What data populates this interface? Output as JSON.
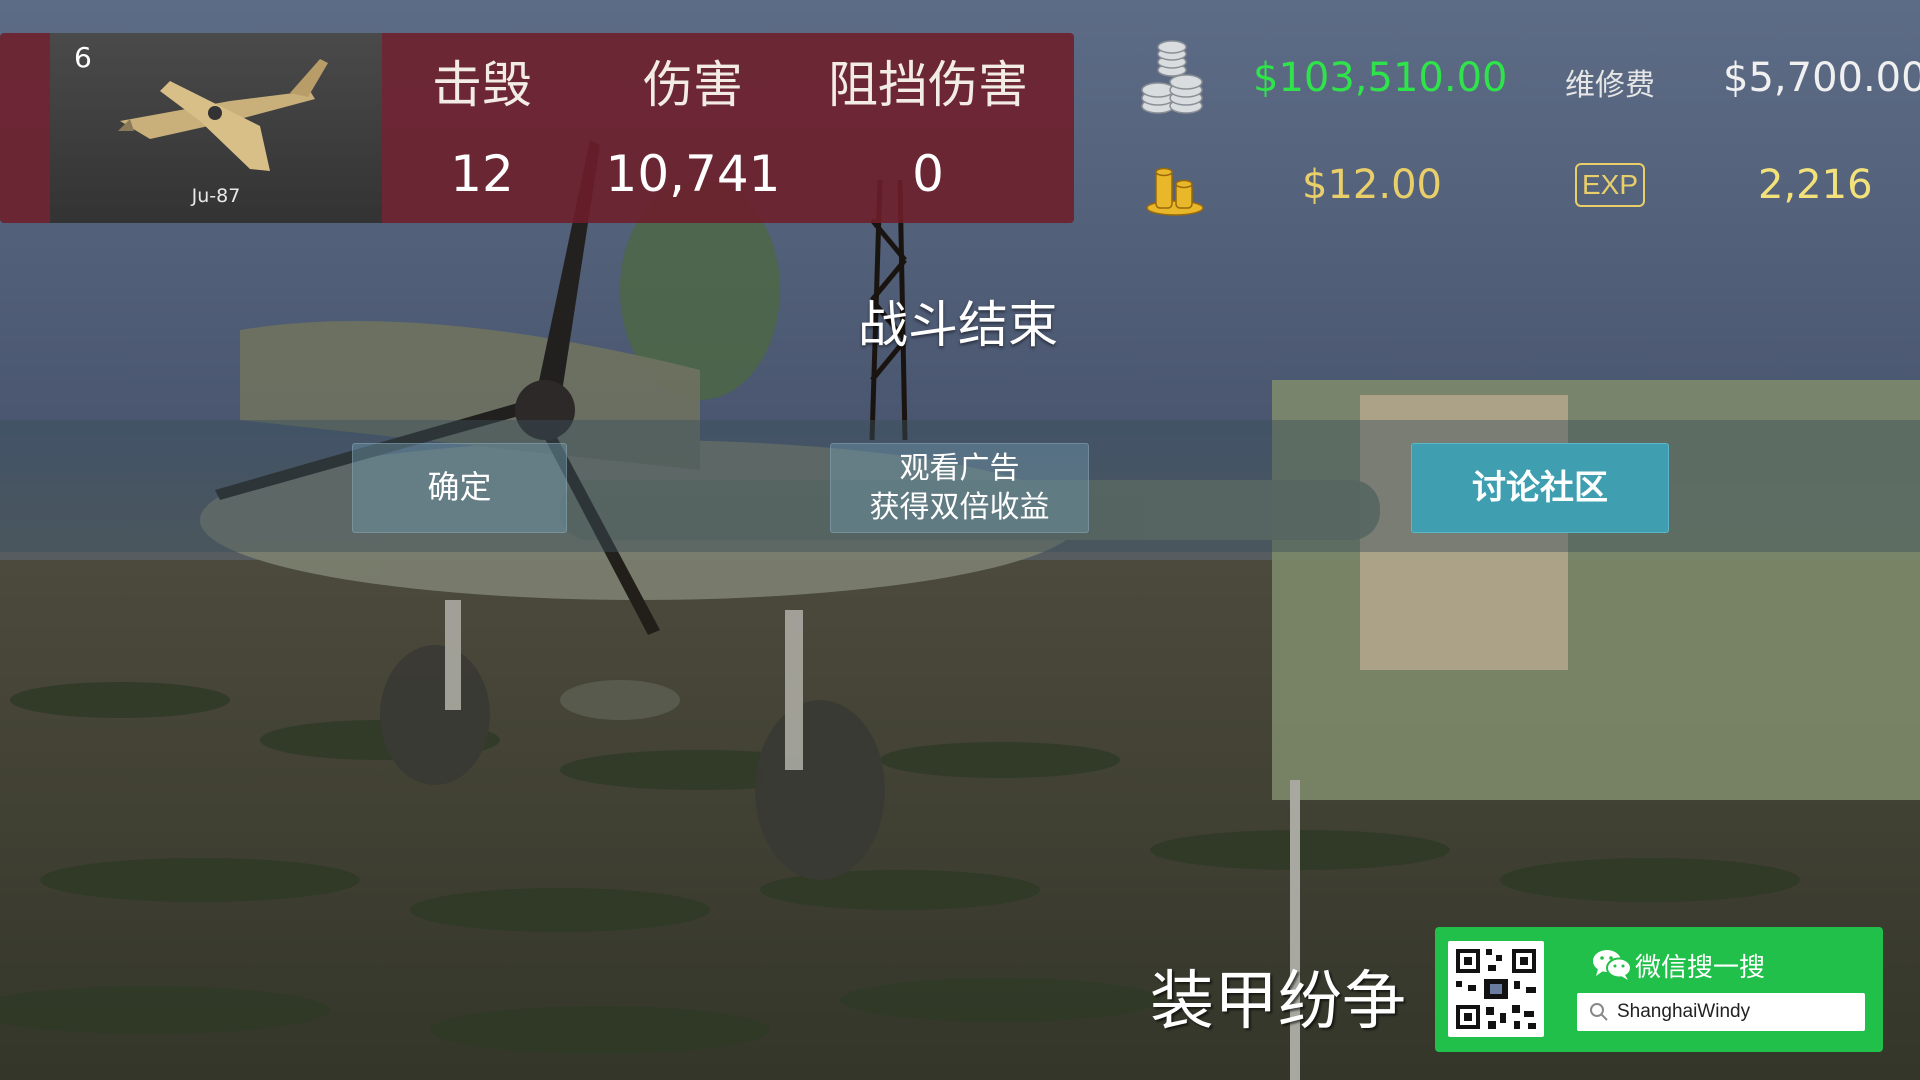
{
  "stats": {
    "plane": {
      "rank": "6",
      "name": "Ju-87"
    },
    "headers": {
      "kills": "击毁",
      "damage": "伤害",
      "blocked": "阻挡伤害"
    },
    "values": {
      "kills": "12",
      "damage": "10,741",
      "blocked": "0"
    }
  },
  "currency": {
    "silver": "$103,510.00",
    "repair_label": "维修费",
    "repair_cost": "$5,700.00",
    "gold": "$12.00",
    "exp_label": "EXP",
    "exp": "2,216"
  },
  "colors": {
    "silver_text": "#2fe34a",
    "gold_text": "#e9cf6a",
    "exp_text": "#f3e27a",
    "panel_bg": "#6e1e2a",
    "community_button": "#3f9fb0",
    "wechat_green": "#21c04a"
  },
  "title": "战斗结束",
  "buttons": {
    "confirm": "确定",
    "watch_ad": "观看广告\n获得双倍收益",
    "community": "讨论社区"
  },
  "branding": {
    "game_logo": "装甲纷争",
    "wechat_title": "微信搜一搜",
    "wechat_search_value": "ShanghaiWindy"
  },
  "icons": [
    "silver-coins-icon",
    "gold-coins-icon",
    "exp-badge-icon",
    "wechat-icon",
    "search-icon",
    "qr-code-icon"
  ]
}
